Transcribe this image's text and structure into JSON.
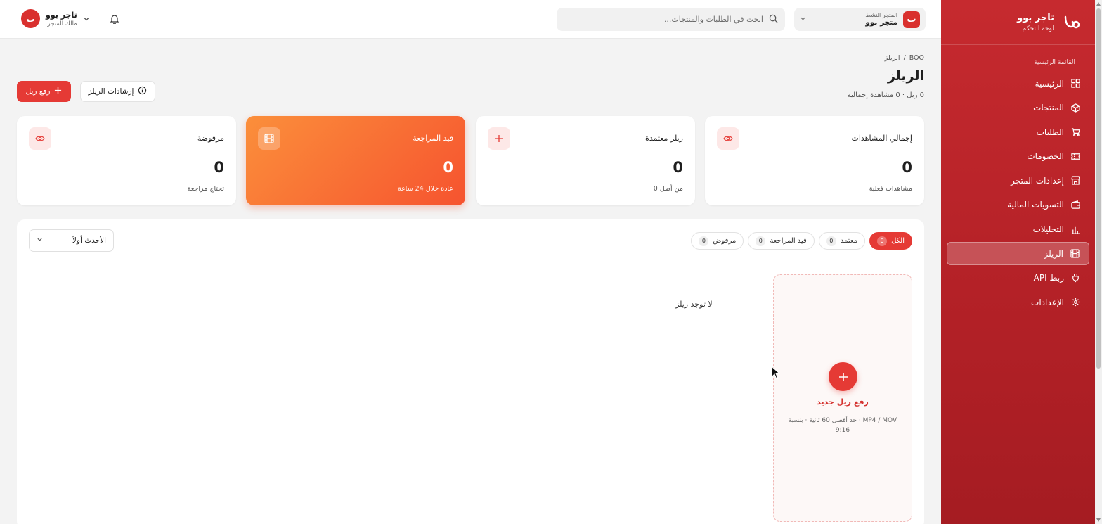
{
  "sidebar": {
    "brand_title": "تاجر بوو",
    "brand_subtitle": "لوحة التحكم",
    "section_label": "القائمة الرئيسية",
    "items": [
      {
        "label": "الرئيسية",
        "icon": "grid-icon"
      },
      {
        "label": "المنتجات",
        "icon": "box-icon"
      },
      {
        "label": "الطلبات",
        "icon": "cart-icon"
      },
      {
        "label": "الخصومات",
        "icon": "ticket-icon"
      },
      {
        "label": "إعدادات المتجر",
        "icon": "store-icon"
      },
      {
        "label": "التسويات المالية",
        "icon": "wallet-icon"
      },
      {
        "label": "التحليلات",
        "icon": "bar-chart-icon"
      },
      {
        "label": "الريلز",
        "icon": "film-icon",
        "active": true
      },
      {
        "label": "ربط API",
        "icon": "plug-icon"
      },
      {
        "label": "الإعدادات",
        "icon": "gear-icon"
      }
    ]
  },
  "topbar": {
    "store_label": "المتجر النشط",
    "store_name": "متجر بوو",
    "store_badge": "ب",
    "search_placeholder": "ابحث في الطلبات والمنتجات...",
    "user_name": "تاجر بوو",
    "user_role": "مالك المتجر",
    "user_avatar": "ب"
  },
  "page": {
    "breadcrumb_root": "BOO",
    "breadcrumb_sep": "/",
    "breadcrumb_current": "الريلز",
    "title": "الريلز",
    "subtitle": "0 ريل · 0 مشاهدة إجمالية",
    "upload_button": "رفع ريل",
    "guide_button": "إرشادات الريلز"
  },
  "stats": [
    {
      "label": "إجمالي المشاهدات",
      "value": "0",
      "hint": "مشاهدات فعلية",
      "icon": "eye-icon"
    },
    {
      "label": "ريلز معتمدة",
      "value": "0",
      "hint": "من أصل 0",
      "icon": "plus-icon"
    },
    {
      "label": "قيد المراجعة",
      "value": "0",
      "hint": "عادة خلال 24 ساعة",
      "icon": "film-icon"
    },
    {
      "label": "مرفوضة",
      "value": "0",
      "hint": "تحتاج مراجعة",
      "icon": "eye-icon"
    }
  ],
  "tabs": [
    {
      "label": "الكل",
      "count": "0",
      "active": true
    },
    {
      "label": "معتمد",
      "count": "0"
    },
    {
      "label": "قيد المراجعة",
      "count": "0"
    },
    {
      "label": "مرفوض",
      "count": "0"
    }
  ],
  "sort": {
    "value": "الأحدث أولاً"
  },
  "empty_text": "لا توجد ريلز",
  "upload_card": {
    "title": "رفع ريل جديد",
    "description": "MP4 / MOV · حد أقصى 60 ثانية · بنسبة 9:16"
  },
  "colors": {
    "brand": "#c62a2f",
    "accent": "#e53a35",
    "orange_start": "#fb8f3b",
    "orange_end": "#f6532f"
  }
}
